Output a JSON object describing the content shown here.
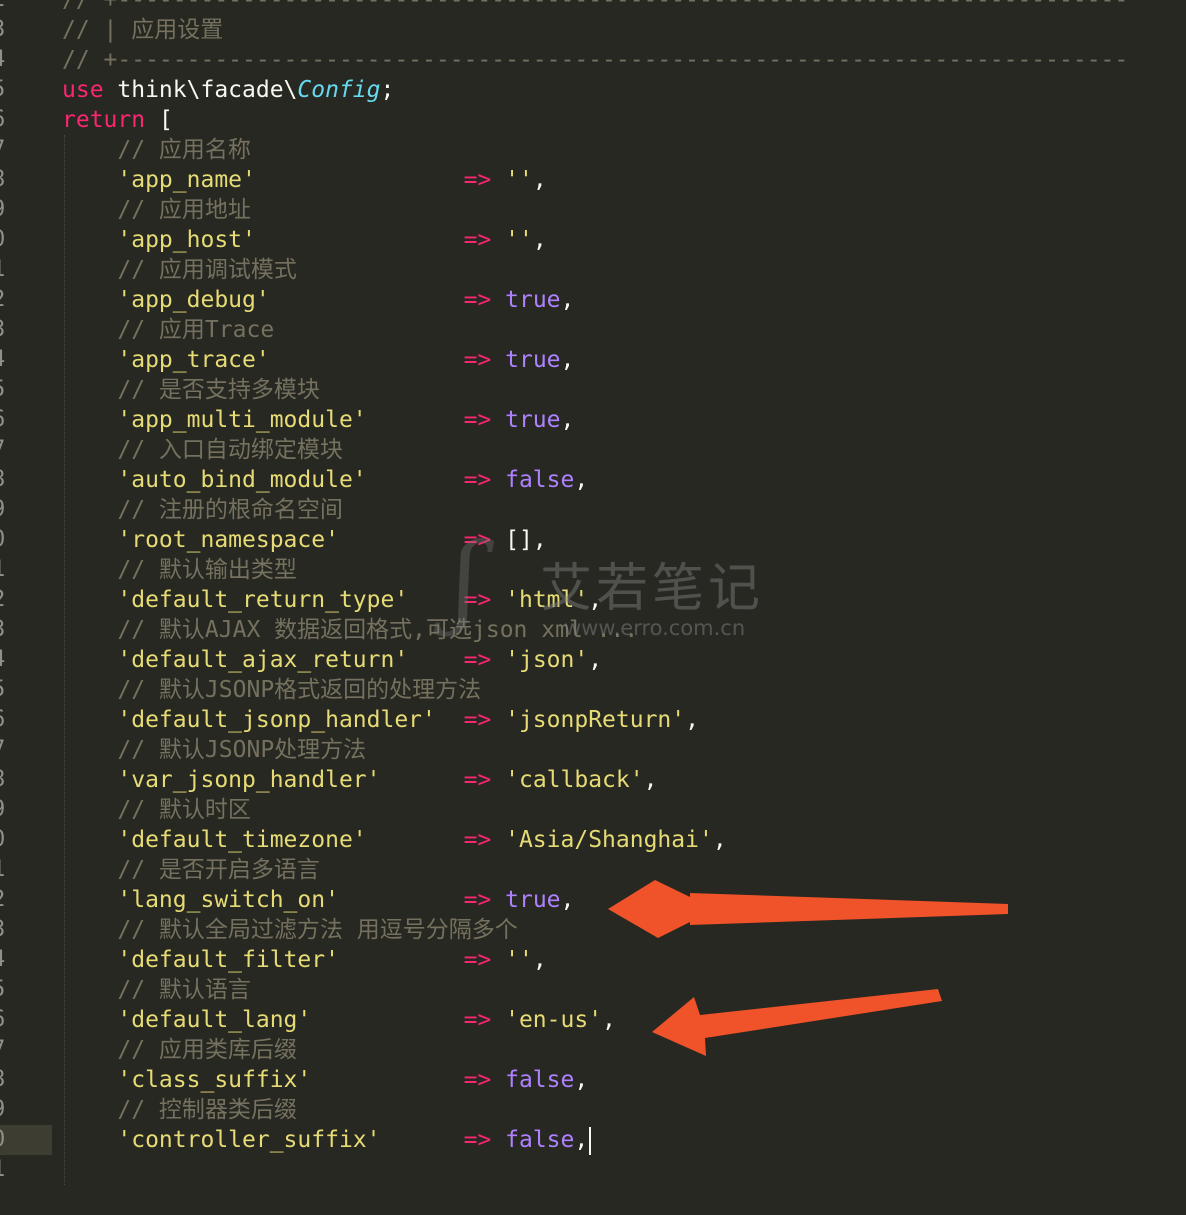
{
  "editor": {
    "lines": [
      {
        "num": "2",
        "tokens": [
          {
            "t": "cm",
            "v": "// +-------------------------------------------------------------------------"
          }
        ]
      },
      {
        "num": "3",
        "tokens": [
          {
            "t": "cm",
            "v": "// | 应用设置"
          }
        ]
      },
      {
        "num": "4",
        "tokens": [
          {
            "t": "cm",
            "v": "// +-------------------------------------------------------------------------"
          }
        ]
      },
      {
        "num": "5",
        "tokens": [
          {
            "t": "kw",
            "v": "use"
          },
          {
            "t": "plain",
            "v": " think\\facade\\"
          },
          {
            "t": "cls",
            "v": "Config"
          },
          {
            "t": "plain",
            "v": ";"
          }
        ]
      },
      {
        "num": "6",
        "tokens": [
          {
            "t": "kw",
            "v": "return"
          },
          {
            "t": "plain",
            "v": " ["
          }
        ]
      },
      {
        "num": "7",
        "tokens": [
          {
            "t": "cm",
            "v": "    // 应用名称"
          }
        ]
      },
      {
        "num": "8",
        "tokens": [
          {
            "t": "str",
            "v": "    'app_name'"
          },
          {
            "t": "op",
            "v": "               =>"
          },
          {
            "t": "str",
            "v": " ''"
          },
          {
            "t": "plain",
            "v": ","
          }
        ]
      },
      {
        "num": "9",
        "tokens": [
          {
            "t": "cm",
            "v": "    // 应用地址"
          }
        ]
      },
      {
        "num": "0",
        "tokens": [
          {
            "t": "str",
            "v": "    'app_host'"
          },
          {
            "t": "op",
            "v": "               =>"
          },
          {
            "t": "str",
            "v": " ''"
          },
          {
            "t": "plain",
            "v": ","
          }
        ]
      },
      {
        "num": "1",
        "tokens": [
          {
            "t": "cm",
            "v": "    // 应用调试模式"
          }
        ]
      },
      {
        "num": "2",
        "tokens": [
          {
            "t": "str",
            "v": "    'app_debug'"
          },
          {
            "t": "op",
            "v": "              =>"
          },
          {
            "t": "bool",
            "v": " true"
          },
          {
            "t": "plain",
            "v": ","
          }
        ]
      },
      {
        "num": "3",
        "tokens": [
          {
            "t": "cm",
            "v": "    // 应用Trace"
          }
        ]
      },
      {
        "num": "4",
        "tokens": [
          {
            "t": "str",
            "v": "    'app_trace'"
          },
          {
            "t": "op",
            "v": "              =>"
          },
          {
            "t": "bool",
            "v": " true"
          },
          {
            "t": "plain",
            "v": ","
          }
        ]
      },
      {
        "num": "5",
        "tokens": [
          {
            "t": "cm",
            "v": "    // 是否支持多模块"
          }
        ]
      },
      {
        "num": "6",
        "tokens": [
          {
            "t": "str",
            "v": "    'app_multi_module'"
          },
          {
            "t": "op",
            "v": "       =>"
          },
          {
            "t": "bool",
            "v": " true"
          },
          {
            "t": "plain",
            "v": ","
          }
        ]
      },
      {
        "num": "7",
        "tokens": [
          {
            "t": "cm",
            "v": "    // 入口自动绑定模块"
          }
        ]
      },
      {
        "num": "8",
        "tokens": [
          {
            "t": "str",
            "v": "    'auto_bind_module'"
          },
          {
            "t": "op",
            "v": "       =>"
          },
          {
            "t": "bool",
            "v": " false"
          },
          {
            "t": "plain",
            "v": ","
          }
        ]
      },
      {
        "num": "9",
        "tokens": [
          {
            "t": "cm",
            "v": "    // 注册的根命名空间"
          }
        ]
      },
      {
        "num": "0",
        "tokens": [
          {
            "t": "str",
            "v": "    'root_namespace'"
          },
          {
            "t": "op",
            "v": "         =>"
          },
          {
            "t": "plain",
            "v": " [],"
          }
        ]
      },
      {
        "num": "1",
        "tokens": [
          {
            "t": "cm",
            "v": "    // 默认输出类型"
          }
        ]
      },
      {
        "num": "2",
        "tokens": [
          {
            "t": "str",
            "v": "    'default_return_type'"
          },
          {
            "t": "op",
            "v": "    =>"
          },
          {
            "t": "str",
            "v": " 'html'"
          },
          {
            "t": "plain",
            "v": ","
          }
        ]
      },
      {
        "num": "3",
        "tokens": [
          {
            "t": "cm",
            "v": "    // 默认AJAX 数据返回格式,可选json xml ..."
          }
        ]
      },
      {
        "num": "4",
        "tokens": [
          {
            "t": "str",
            "v": "    'default_ajax_return'"
          },
          {
            "t": "op",
            "v": "    =>"
          },
          {
            "t": "str",
            "v": " 'json'"
          },
          {
            "t": "plain",
            "v": ","
          }
        ]
      },
      {
        "num": "5",
        "tokens": [
          {
            "t": "cm",
            "v": "    // 默认JSONP格式返回的处理方法"
          }
        ]
      },
      {
        "num": "6",
        "tokens": [
          {
            "t": "str",
            "v": "    'default_jsonp_handler'"
          },
          {
            "t": "op",
            "v": "  =>"
          },
          {
            "t": "str",
            "v": " 'jsonpReturn'"
          },
          {
            "t": "plain",
            "v": ","
          }
        ]
      },
      {
        "num": "7",
        "tokens": [
          {
            "t": "cm",
            "v": "    // 默认JSONP处理方法"
          }
        ]
      },
      {
        "num": "8",
        "tokens": [
          {
            "t": "str",
            "v": "    'var_jsonp_handler'"
          },
          {
            "t": "op",
            "v": "      =>"
          },
          {
            "t": "str",
            "v": " 'callback'"
          },
          {
            "t": "plain",
            "v": ","
          }
        ]
      },
      {
        "num": "9",
        "tokens": [
          {
            "t": "cm",
            "v": "    // 默认时区"
          }
        ]
      },
      {
        "num": "0",
        "tokens": [
          {
            "t": "str",
            "v": "    'default_timezone'"
          },
          {
            "t": "op",
            "v": "       =>"
          },
          {
            "t": "str",
            "v": " 'Asia/Shanghai'"
          },
          {
            "t": "plain",
            "v": ","
          }
        ]
      },
      {
        "num": "1",
        "tokens": [
          {
            "t": "cm",
            "v": "    // 是否开启多语言"
          }
        ]
      },
      {
        "num": "2",
        "tokens": [
          {
            "t": "str",
            "v": "    'lang_switch_on'"
          },
          {
            "t": "op",
            "v": "         =>"
          },
          {
            "t": "bool",
            "v": " true"
          },
          {
            "t": "plain",
            "v": ","
          }
        ]
      },
      {
        "num": "3",
        "tokens": [
          {
            "t": "cm",
            "v": "    // 默认全局过滤方法 用逗号分隔多个"
          }
        ]
      },
      {
        "num": "4",
        "tokens": [
          {
            "t": "str",
            "v": "    'default_filter'"
          },
          {
            "t": "op",
            "v": "         =>"
          },
          {
            "t": "str",
            "v": " ''"
          },
          {
            "t": "plain",
            "v": ","
          }
        ]
      },
      {
        "num": "5",
        "tokens": [
          {
            "t": "cm",
            "v": "    // 默认语言"
          }
        ]
      },
      {
        "num": "6",
        "tokens": [
          {
            "t": "str",
            "v": "    'default_lang'"
          },
          {
            "t": "op",
            "v": "           =>"
          },
          {
            "t": "str",
            "v": " 'en-us'"
          },
          {
            "t": "plain",
            "v": ","
          }
        ]
      },
      {
        "num": "7",
        "tokens": [
          {
            "t": "cm",
            "v": "    // 应用类库后缀"
          }
        ]
      },
      {
        "num": "8",
        "tokens": [
          {
            "t": "str",
            "v": "    'class_suffix'"
          },
          {
            "t": "op",
            "v": "           =>"
          },
          {
            "t": "bool",
            "v": " false"
          },
          {
            "t": "plain",
            "v": ","
          }
        ]
      },
      {
        "num": "9",
        "tokens": [
          {
            "t": "cm",
            "v": "    // 控制器类后缀"
          }
        ]
      },
      {
        "num": "0",
        "tokens": [
          {
            "t": "str",
            "v": "    'controller_suffix'"
          },
          {
            "t": "op",
            "v": "      =>"
          },
          {
            "t": "bool",
            "v": " false"
          },
          {
            "t": "plain",
            "v": ","
          }
        ],
        "current": true
      },
      {
        "num": "1",
        "tokens": []
      }
    ]
  },
  "watermark": {
    "title": "艾若笔记",
    "url": "www.erro.com.cn"
  },
  "colors": {
    "background": "#272822",
    "comment": "#75715e",
    "keyword": "#f92672",
    "string": "#e6db74",
    "boolean": "#ae81ff",
    "class": "#66d9ef",
    "arrow": "#f0522a"
  }
}
